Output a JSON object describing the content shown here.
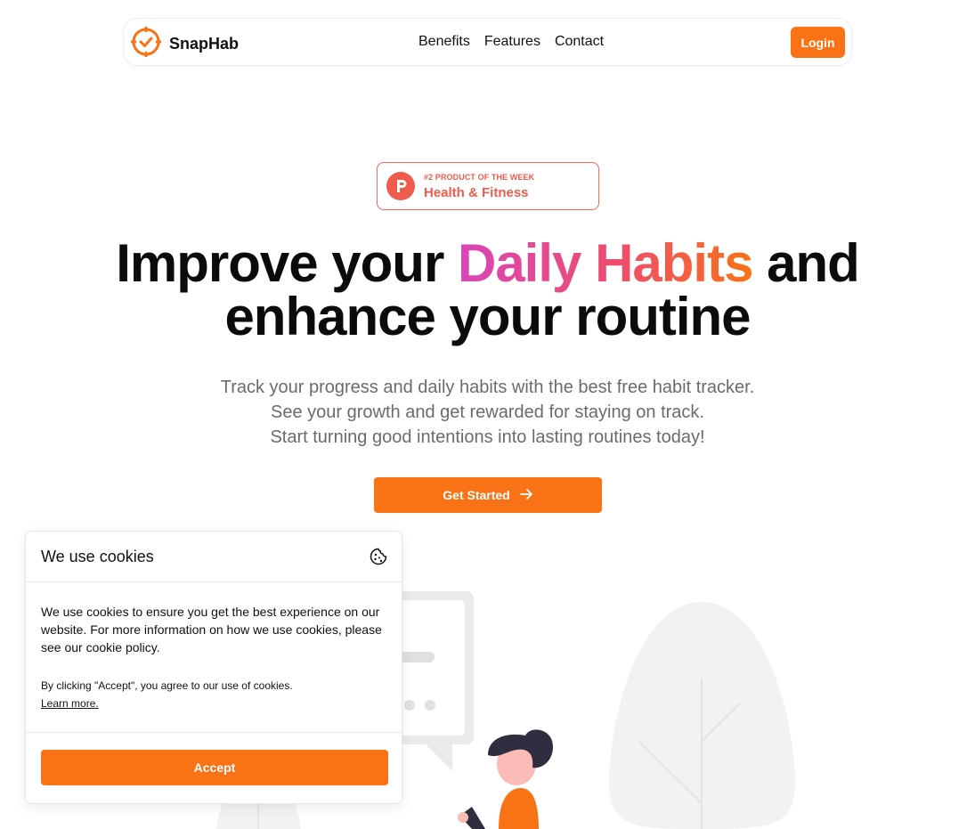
{
  "brand": {
    "name": "SnapHab",
    "logo_icon": "target-check-icon",
    "accent": "#f97316"
  },
  "nav": {
    "links": [
      "Benefits",
      "Features",
      "Contact"
    ],
    "login_label": "Login"
  },
  "badge": {
    "icon": "producthunt-icon",
    "kicker": "#2 PRODUCT OF THE WEEK",
    "title": "Health & Fitness",
    "color": "#ef5b4c"
  },
  "hero": {
    "headline_pre": "Improve your",
    "headline_highlight": "Daily Habits",
    "headline_post": "and",
    "headline_line2": "enhance your routine",
    "sub_lines": [
      "Track your progress and daily habits with the best free habit tracker.",
      "See your growth and get rewarded for staying on track.",
      "Start turning good intentions into lasting routines today!"
    ],
    "cta_label": "Get Started",
    "cta_icon": "arrow-right-icon"
  },
  "cookie": {
    "title": "We use cookies",
    "icon": "cookie-icon",
    "body": "We use cookies to ensure you get the best experience on our website. For more information on how we use cookies, please see our cookie policy.",
    "note": "By clicking \"Accept\", you agree to our use of cookies.",
    "learn_more": "Learn more.",
    "accept_label": "Accept"
  },
  "colors": {
    "accent": "#f97316",
    "gradient_start": "#d946b8",
    "gradient_end": "#f97316",
    "subtext": "#6b6b6b"
  }
}
